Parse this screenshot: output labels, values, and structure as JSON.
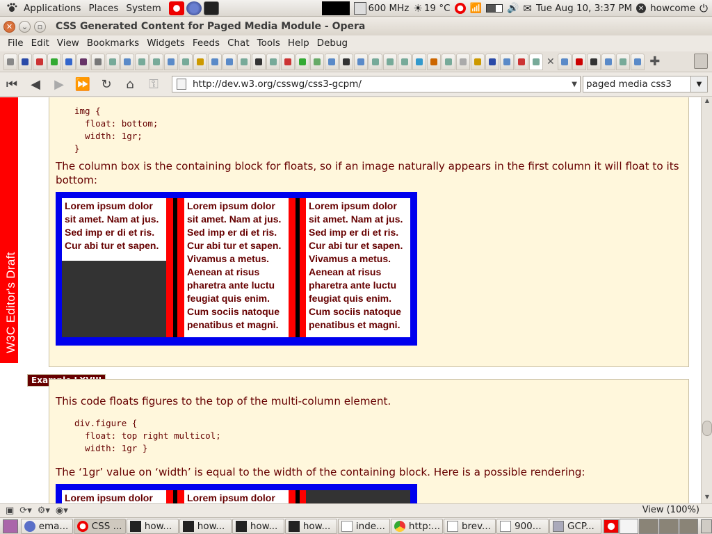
{
  "panel": {
    "menus": [
      "Applications",
      "Places",
      "System"
    ],
    "cpu": "600 MHz",
    "temp": "19 °C",
    "clock": "Tue Aug 10,  3:37 PM",
    "user": "howcome"
  },
  "window": {
    "title": "CSS Generated Content for Paged Media Module - Opera"
  },
  "menubar": [
    "File",
    "Edit",
    "View",
    "Bookmarks",
    "Widgets",
    "Feeds",
    "Chat",
    "Tools",
    "Help",
    "Debug"
  ],
  "toolbar": {
    "url": "http://dev.w3.org/csswg/css3-gcpm/",
    "search": "paged media css3"
  },
  "sticker": "W3C Editor's Draft",
  "content": {
    "code1": "img {\n  float: bottom;\n  width: 1gr;\n}",
    "para1": "The column box is the containing block for floats, so if an image naturally appears in the first column it will float to its bottom:",
    "col_short": "Lorem ipsum dolor sit amet. Nam at jus. Sed imp er di et ris. Cur abi tur et sapen.",
    "col_long": "Lorem ipsum dolor sit amet. Nam at jus. Sed imp er di et ris. Cur abi tur et sapen. Vivamus a metus. Aenean at risus pharetra ante luctu feugiat quis enim. Cum sociis natoque penatibus et magni.",
    "example_label": "Example LXVIII",
    "para2": "This code floats figures to the top of the multi-column element.",
    "code2": "div.figure {\n  float: top right multicol;\n  width: 1gr }",
    "para3": "The ‘1gr’ value on ‘width’ is equal to the width of the containing block. Here is a possible rendering:",
    "col_head": "Lorem ipsum dolor"
  },
  "status": {
    "zoom": "View (100%)"
  },
  "taskbar": [
    "ema...",
    "CSS ...",
    "how...",
    "how...",
    "how...",
    "how...",
    "inde...",
    "http:...",
    "brev...",
    "900...",
    "GCP..."
  ],
  "colors": {
    "accent_red": "#ff0000",
    "column_border": "#0000ee",
    "text_maroon": "#660000",
    "example_bg": "#fff7dc"
  }
}
